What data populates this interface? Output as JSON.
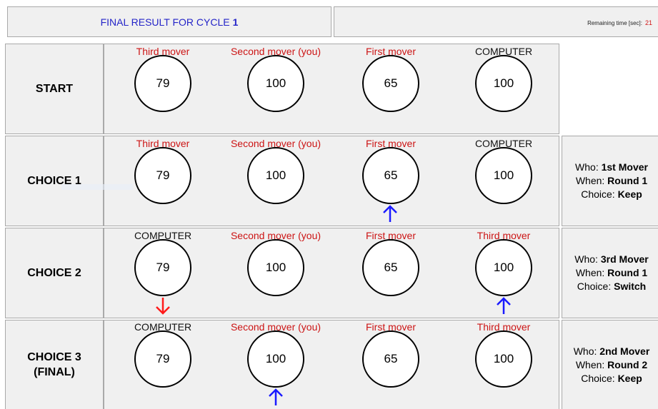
{
  "header": {
    "title_prefix": "FINAL RESULT FOR CYCLE",
    "cycle": "1",
    "timer_label": "Remaining time [sec]:",
    "timer_value": "21"
  },
  "rows": [
    {
      "label": "START",
      "slots": [
        {
          "label": "Third mover",
          "value": "79"
        },
        {
          "label": "Second mover (you)",
          "value": "100"
        },
        {
          "label": "First mover",
          "value": "65"
        },
        {
          "label": "COMPUTER",
          "value": "100"
        }
      ]
    },
    {
      "label": "CHOICE 1",
      "slots": [
        {
          "label": "Third mover",
          "value": "79"
        },
        {
          "label": "Second mover (you)",
          "value": "100"
        },
        {
          "label": "First mover",
          "value": "65"
        },
        {
          "label": "COMPUTER",
          "value": "100"
        }
      ],
      "info": {
        "who_label": "Who:",
        "who": "1st Mover",
        "when_label": "When:",
        "when": "Round 1",
        "choice_label": "Choice:",
        "choice": "Keep"
      }
    },
    {
      "label": "CHOICE 2",
      "slots": [
        {
          "label": "COMPUTER",
          "value": "79"
        },
        {
          "label": "Second mover (you)",
          "value": "100"
        },
        {
          "label": "First mover",
          "value": "65"
        },
        {
          "label": "Third mover",
          "value": "100"
        }
      ],
      "info": {
        "who_label": "Who:",
        "who": "3rd Mover",
        "when_label": "When:",
        "when": "Round 1",
        "choice_label": "Choice:",
        "choice": "Switch"
      }
    },
    {
      "label_line1": "CHOICE 3",
      "label_line2": "(FINAL)",
      "slots": [
        {
          "label": "COMPUTER",
          "value": "79"
        },
        {
          "label": "Second mover (you)",
          "value": "100"
        },
        {
          "label": "First mover",
          "value": "65"
        },
        {
          "label": "Third mover",
          "value": "100"
        }
      ],
      "info": {
        "who_label": "Who:",
        "who": "2nd Mover",
        "when_label": "When:",
        "when": "Round 2",
        "choice_label": "Choice:",
        "choice": "Keep"
      }
    }
  ],
  "colors": {
    "header_text": "#2424c8",
    "mover_label": "#cc1414",
    "arrow_up": "#1a1aff",
    "arrow_down": "#ff1a1a"
  },
  "icons": [
    "arrow-up-icon",
    "arrow-down-icon"
  ]
}
